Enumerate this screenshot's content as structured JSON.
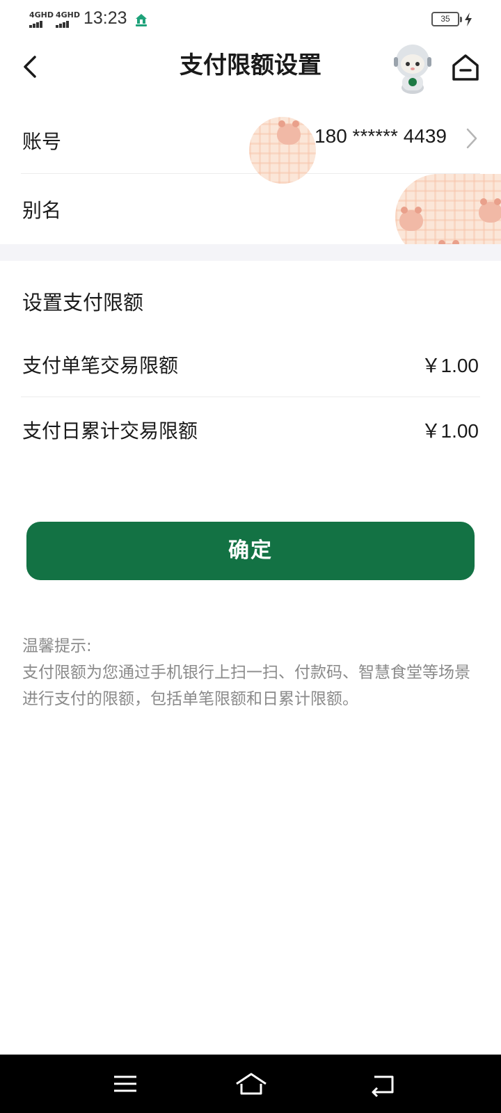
{
  "status_bar": {
    "signal_1": "4GHD",
    "signal_2": "4GHD",
    "time": "13:23",
    "battery": "35"
  },
  "header": {
    "title": "支付限额设置"
  },
  "account": {
    "label": "账号",
    "value": "180 ****** 4439"
  },
  "alias": {
    "label": "别名"
  },
  "limits": {
    "section_title": "设置支付限额",
    "single": {
      "label": "支付单笔交易限额",
      "value": "￥1.00"
    },
    "daily": {
      "label": "支付日累计交易限额",
      "value": "￥1.00"
    }
  },
  "confirm_label": "确定",
  "tips": {
    "title": "温馨提示:",
    "body": "支付限额为您通过手机银行上扫一扫、付款码、智慧食堂等场景进行支付的限额，包括单笔限额和日累计限额。"
  },
  "colors": {
    "primary": "#137244",
    "divider": "#ececec",
    "gap": "#f4f4f8",
    "tip_text": "#8a8a8a"
  },
  "icons": [
    "back-arrow-icon",
    "mascot-robot-icon",
    "home-icon",
    "chevron-right-icon",
    "menu-icon",
    "system-home-icon",
    "system-back-icon",
    "charging-bolt-icon"
  ]
}
